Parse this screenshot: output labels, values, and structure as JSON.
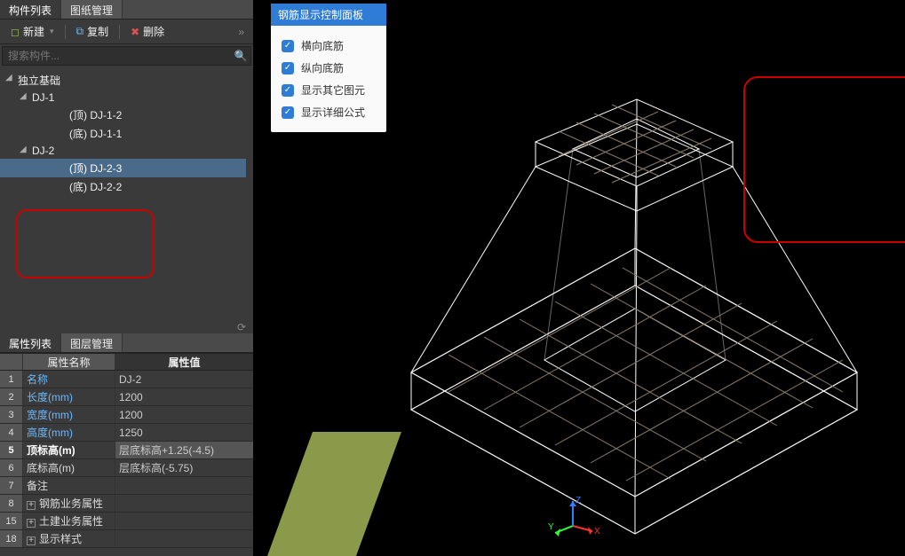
{
  "tabs_top": {
    "components": "构件列表",
    "drawings": "图纸管理"
  },
  "toolbar": {
    "new": "新建",
    "copy": "复制",
    "delete": "删除"
  },
  "search": {
    "placeholder": "搜索构件..."
  },
  "tree": {
    "root": "独立基础",
    "dj1": "DJ-1",
    "dj1_top": "(顶)  DJ-1-2",
    "dj1_bot": "(底)  DJ-1-1",
    "dj2": "DJ-2",
    "dj2_top": "(顶)  DJ-2-3",
    "dj2_bot": "(底)  DJ-2-2"
  },
  "tabs_bottom": {
    "props": "属性列表",
    "layers": "图层管理"
  },
  "prop_header": {
    "name": "属性名称",
    "value": "属性值"
  },
  "props": [
    {
      "n": "1",
      "k": "名称",
      "v": "DJ-2",
      "link": true
    },
    {
      "n": "2",
      "k": "长度(mm)",
      "v": "1200",
      "link": true
    },
    {
      "n": "3",
      "k": "宽度(mm)",
      "v": "1200",
      "link": true
    },
    {
      "n": "4",
      "k": "高度(mm)",
      "v": "1250",
      "link": true
    },
    {
      "n": "5",
      "k": "顶标高(m)",
      "v": "层底标高+1.25(-4.5)",
      "bold": true
    },
    {
      "n": "6",
      "k": "底标高(m)",
      "v": "层底标高(-5.75)"
    },
    {
      "n": "7",
      "k": "备注",
      "v": ""
    },
    {
      "n": "8",
      "k": "钢筋业务属性",
      "v": "",
      "exp": true
    },
    {
      "n": "15",
      "k": "土建业务属性",
      "v": "",
      "exp": true
    },
    {
      "n": "18",
      "k": "显示样式",
      "v": "",
      "exp": true
    }
  ],
  "rebar_panel": {
    "title": "钢筋显示控制面板",
    "items": [
      "横向底筋",
      "纵向底筋",
      "显示其它图元",
      "显示详细公式"
    ]
  },
  "axis": {
    "x": "X",
    "y": "Y",
    "z": "Z"
  }
}
